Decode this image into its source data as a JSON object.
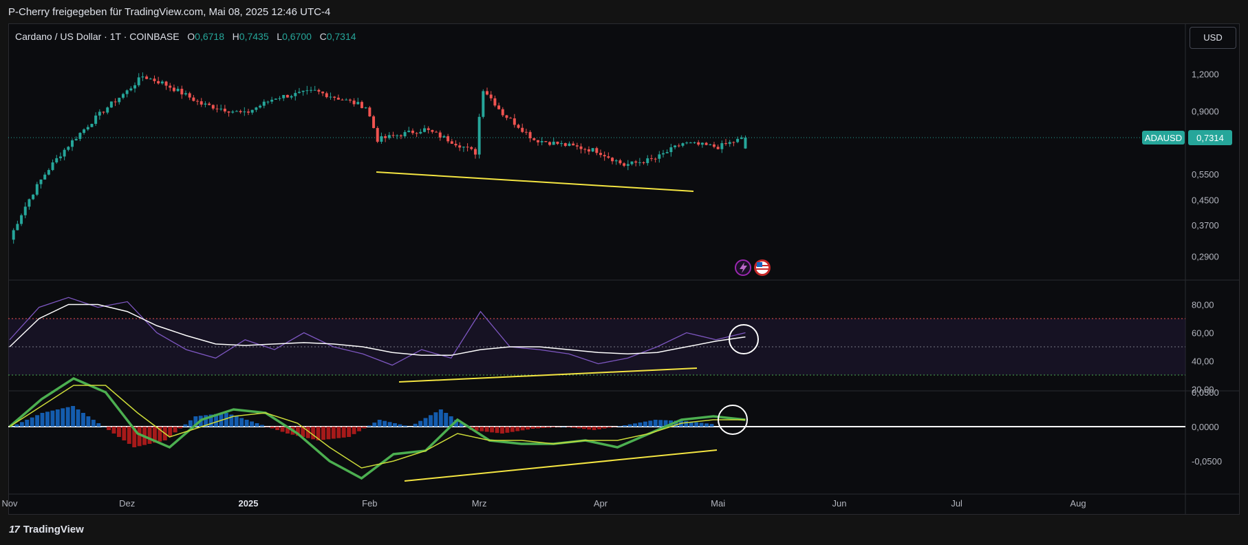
{
  "header": {
    "share_text": "P-Cherry freigegeben für TradingView.com, Mai 08, 2025 12:46 UTC-4"
  },
  "legend": {
    "symbol": "Cardano / US Dollar · 1T · COINBASE",
    "open_label": "O",
    "open": "0,6718",
    "high_label": "H",
    "high": "0,7435",
    "low_label": "L",
    "low": "0,6700",
    "close_label": "C",
    "close": "0,7314"
  },
  "currency_button": "USD",
  "price_tag": {
    "symbol": "ADAUSD",
    "value": "0,7314"
  },
  "footer": {
    "brand": "TradingView",
    "brand_mark": "17"
  },
  "icons": {
    "flash": "lightning-icon",
    "flag": "us-flag-icon"
  },
  "colors": {
    "up": "#26a69a",
    "down": "#ef5350",
    "trendline": "#f5e642",
    "rsi": "#7e57c2",
    "rsi_ma": "#ffffff"
  },
  "chart_data": [
    {
      "type": "candlestick",
      "title": "Cardano / US Dollar · 1T · COINBASE",
      "scale": "log",
      "price_ticks": [
        "1,2000",
        "0,9000",
        "0,5500",
        "0,4500",
        "0,3700",
        "0,2900"
      ],
      "x_ticks": [
        "Nov",
        "Dez",
        "2025",
        "Feb",
        "Mrz",
        "Apr",
        "Mai",
        "Jun",
        "Jul",
        "Aug"
      ],
      "approx_close_path": [
        {
          "date": "2024-11-01",
          "close": 0.33
        },
        {
          "date": "2024-11-10",
          "close": 0.55
        },
        {
          "date": "2024-11-20",
          "close": 0.78
        },
        {
          "date": "2024-12-01",
          "close": 1.05
        },
        {
          "date": "2024-12-05",
          "close": 1.18
        },
        {
          "date": "2024-12-10",
          "close": 1.12
        },
        {
          "date": "2024-12-20",
          "close": 0.95
        },
        {
          "date": "2024-12-31",
          "close": 0.88
        },
        {
          "date": "2025-01-08",
          "close": 1.0
        },
        {
          "date": "2025-01-18",
          "close": 1.05
        },
        {
          "date": "2025-01-31",
          "close": 0.93
        },
        {
          "date": "2025-02-03",
          "close": 0.72
        },
        {
          "date": "2025-02-15",
          "close": 0.78
        },
        {
          "date": "2025-02-28",
          "close": 0.65
        },
        {
          "date": "2025-03-02",
          "close": 1.07
        },
        {
          "date": "2025-03-07",
          "close": 0.88
        },
        {
          "date": "2025-03-15",
          "close": 0.72
        },
        {
          "date": "2025-03-31",
          "close": 0.66
        },
        {
          "date": "2025-04-07",
          "close": 0.59
        },
        {
          "date": "2025-04-15",
          "close": 0.62
        },
        {
          "date": "2025-04-22",
          "close": 0.7
        },
        {
          "date": "2025-05-01",
          "close": 0.68
        },
        {
          "date": "2025-05-08",
          "close": 0.7314
        }
      ],
      "last": {
        "open": 0.6718,
        "high": 0.7435,
        "low": 0.67,
        "close": 0.7314
      }
    },
    {
      "type": "line",
      "indicator": "RSI",
      "y_ticks": [
        "80,00",
        "60,00",
        "40,00",
        "20,00"
      ],
      "levels": [
        70,
        50,
        30
      ],
      "series": [
        {
          "values": [
            55,
            78,
            85,
            78,
            82,
            60,
            48,
            42,
            55,
            48,
            60,
            50,
            45,
            37,
            48,
            42,
            75,
            50,
            48,
            45,
            38,
            42,
            50,
            60,
            55,
            60
          ]
        },
        {
          "values": [
            50,
            70,
            80,
            80,
            75,
            65,
            58,
            52,
            51,
            52,
            53,
            52,
            50,
            46,
            44,
            44,
            48,
            50,
            50,
            48,
            46,
            45,
            46,
            50,
            54,
            57
          ]
        }
      ]
    },
    {
      "type": "line",
      "indicator": "MACD",
      "y_ticks": [
        "0,0500",
        "0,0000",
        "-0,0500"
      ],
      "series": [
        {
          "values": [
            0.0,
            0.04,
            0.07,
            0.05,
            -0.01,
            -0.03,
            0.01,
            0.025,
            0.02,
            -0.01,
            -0.05,
            -0.075,
            -0.04,
            -0.035,
            0.01,
            -0.02,
            -0.025,
            -0.025,
            -0.02,
            -0.03,
            -0.01,
            0.01,
            0.015,
            0.01
          ]
        },
        {
          "values": [
            0.0,
            0.03,
            0.06,
            0.06,
            0.02,
            -0.015,
            0.0,
            0.015,
            0.02,
            0.005,
            -0.03,
            -0.06,
            -0.05,
            -0.035,
            -0.01,
            -0.02,
            -0.02,
            -0.025,
            -0.02,
            -0.02,
            -0.01,
            0.005,
            0.01,
            0.01
          ]
        }
      ],
      "histogram": [
        0.0,
        0.02,
        0.03,
        0.0,
        -0.03,
        -0.02,
        0.015,
        0.02,
        0.005,
        -0.01,
        -0.02,
        -0.015,
        0.01,
        0.0,
        0.025,
        -0.005,
        -0.01,
        -0.003,
        0.0,
        -0.005,
        0.002,
        0.01,
        0.008,
        0.003
      ]
    }
  ]
}
